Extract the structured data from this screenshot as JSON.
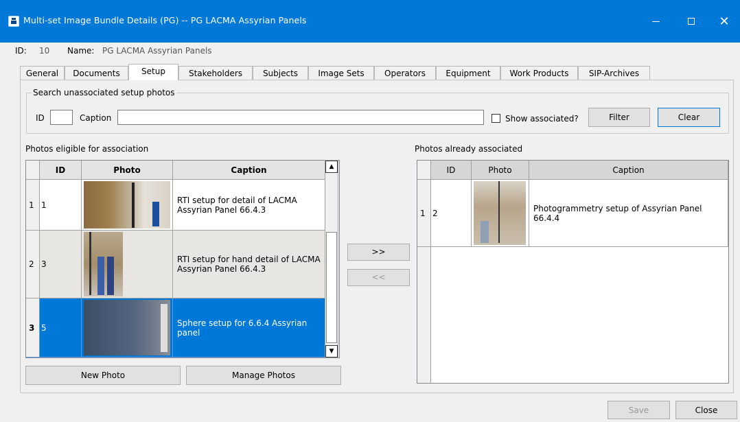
{
  "window": {
    "title": "Multi-set Image Bundle Details (PG) -- PG LACMA Assyrian Panels",
    "app_icon": "dlh-app-icon"
  },
  "header": {
    "id_label": "ID:",
    "id_value": "10",
    "name_label": "Name:",
    "name_value": "PG LACMA Assyrian Panels"
  },
  "tabs": [
    {
      "label": "General"
    },
    {
      "label": "Documents"
    },
    {
      "label": "Setup",
      "active": true
    },
    {
      "label": "Stakeholders"
    },
    {
      "label": "Subjects"
    },
    {
      "label": "Image Sets"
    },
    {
      "label": "Operators"
    },
    {
      "label": "Equipment"
    },
    {
      "label": "Work Products"
    },
    {
      "label": "SIP-Archives"
    }
  ],
  "search": {
    "group_label": "Search unassociated setup photos",
    "id_label": "ID",
    "id_value": "",
    "caption_label": "Caption",
    "caption_value": "",
    "show_associated_label": "Show associated?",
    "show_associated_checked": false,
    "filter_label": "Filter",
    "clear_label": "Clear"
  },
  "eligible": {
    "label": "Photos eligible for association",
    "columns": [
      "ID",
      "Photo",
      "Caption"
    ],
    "rows": [
      {
        "row_num": "1",
        "id": "1",
        "caption": "RTI setup for detail of LACMA Assyrian Panel 66.4.3"
      },
      {
        "row_num": "2",
        "id": "3",
        "caption": "RTI setup for hand detail of LACMA Assyrian Panel 66.4.3"
      },
      {
        "row_num": "3",
        "id": "5",
        "caption": "Sphere setup for 6.6.4 Assyrian panel",
        "selected": true
      }
    ]
  },
  "associated": {
    "label": "Photos already associated",
    "columns": [
      "ID",
      "Photo",
      "Caption"
    ],
    "rows": [
      {
        "row_num": "1",
        "id": "2",
        "caption": "Photogrammetry setup of Assyrian Panel 66.4.4"
      }
    ]
  },
  "transfer": {
    "add_label": ">>",
    "remove_label": "<<"
  },
  "bottom": {
    "new_photo_label": "New Photo",
    "manage_photos_label": "Manage Photos",
    "save_label": "Save",
    "close_label": "Close"
  }
}
